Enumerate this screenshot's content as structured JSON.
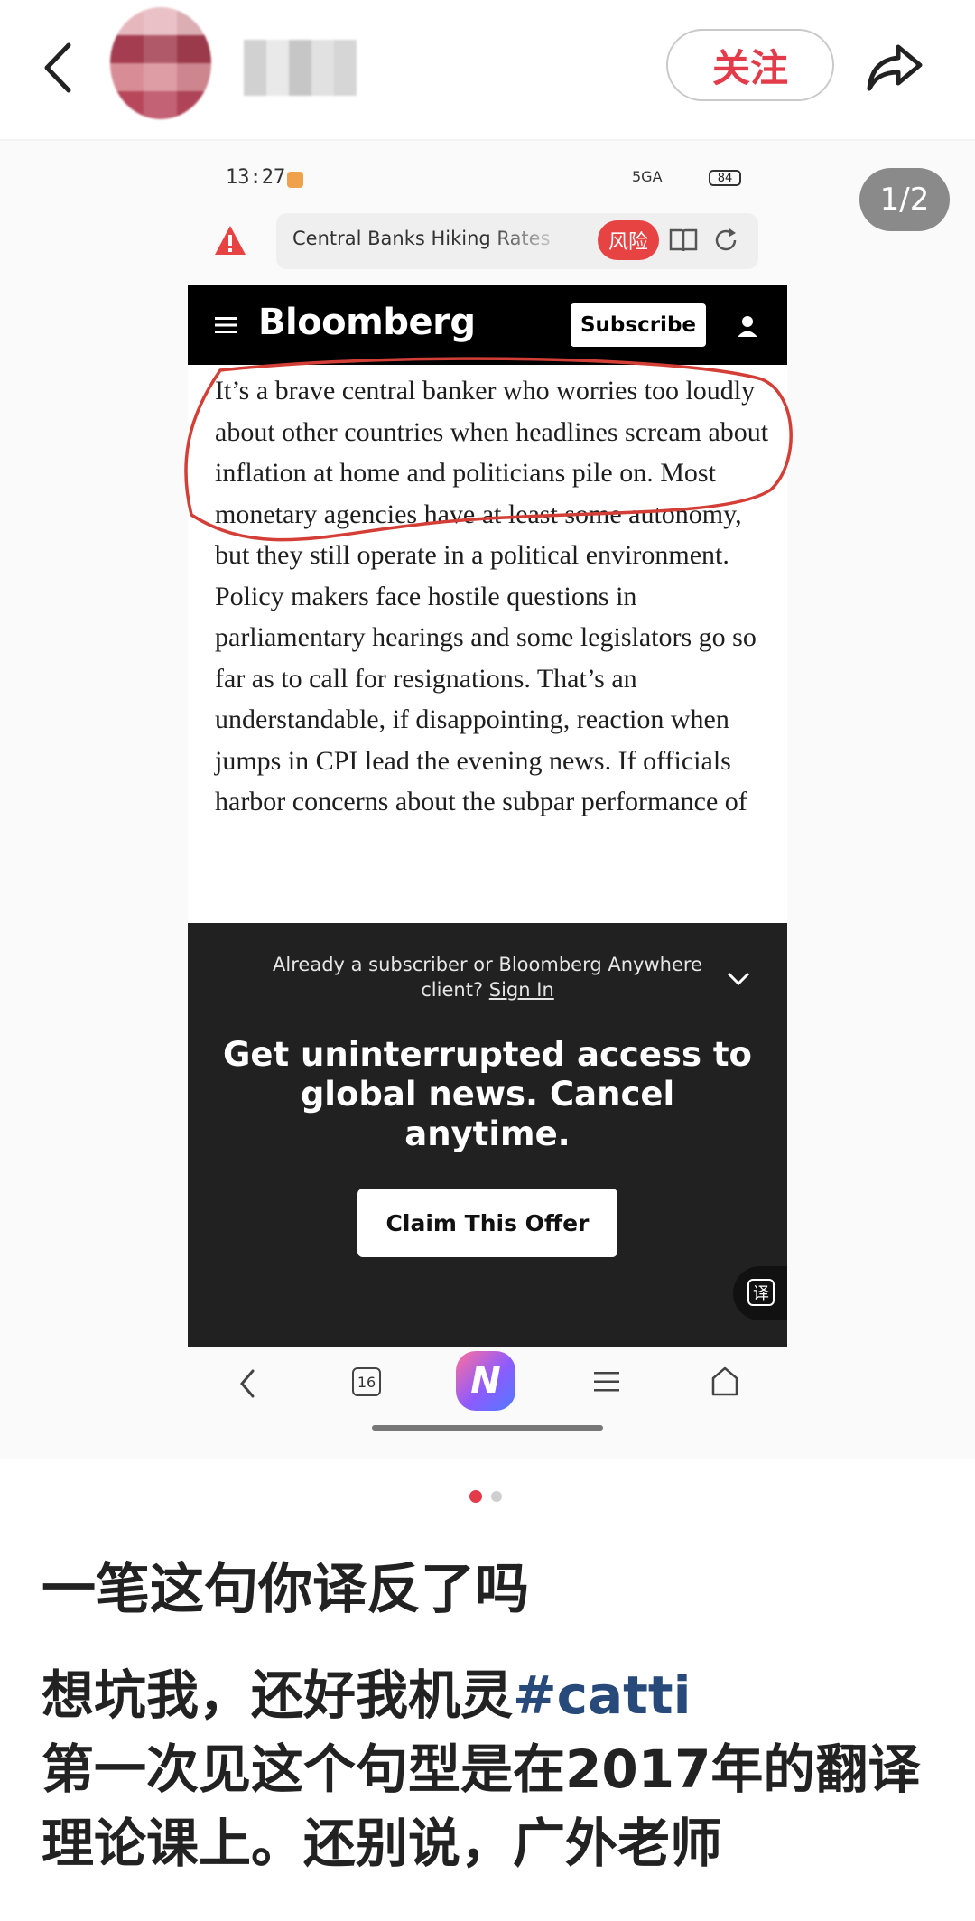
{
  "header": {
    "follow_label": "关注"
  },
  "screenshot": {
    "page_counter": "1/2",
    "status_bar": {
      "time": "13:27",
      "network": "5GA",
      "battery": "84"
    },
    "browser": {
      "url_text": "Central Banks Hiking Rates in",
      "risk_badge": "风险",
      "tab_count": "16",
      "app_button": "N"
    },
    "bloomberg": {
      "brand": "Bloomberg",
      "subscribe_label": "Subscribe",
      "article_text": "It’s a brave central banker who worries too loudly about other countries when headlines scream about inflation at home and politicians pile on. Most monetary agencies have at least some autonomy, but they still operate in a political environment. Policy makers face hostile questions in parliamentary hearings and some legislators go so far as to call for resignations. That’s an understandable, if disappointing, reaction when jumps in CPI lead the evening news. If officials harbor concerns about the subpar performance of",
      "signin_prompt": "Already a subscriber or Bloomberg Anywhere client?",
      "signin_link": "Sign In",
      "offer_headline": "Get uninterrupted access to global news. Cancel anytime.",
      "offer_button": "Claim This Offer",
      "translate_label": "译"
    }
  },
  "post": {
    "title": "一笔这句你译反了吗",
    "body_prefix": "想坑我，还好我机灵",
    "hashtag": "#catti",
    "body_rest": "第一次见这个句型是在2017年的翻译理论课上。还别说，广外老师"
  },
  "colors": {
    "accent_red": "#e33b4a",
    "hashtag_blue": "#274a7a",
    "bloomberg_black": "#000000",
    "overlay_dark": "#212121"
  }
}
